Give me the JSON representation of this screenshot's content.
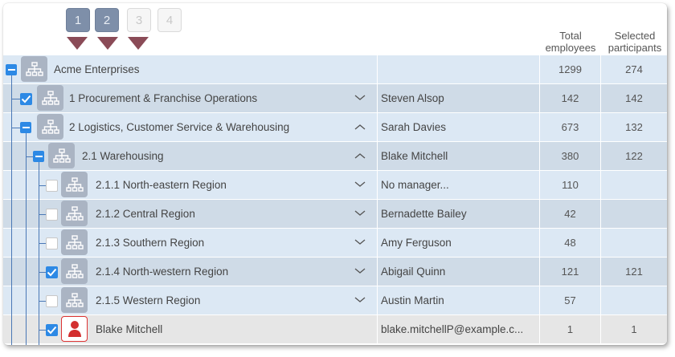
{
  "levels": [
    "1",
    "2",
    "3",
    "4"
  ],
  "headers": {
    "total": "Total employees",
    "selected": "Selected participants"
  },
  "colors": {
    "row_light": "#dce8f4",
    "row_dark": "#cfdbe7",
    "row_person": "#e6e6e6",
    "accent": "#2d89e5",
    "level_marker": "#8a4b57"
  },
  "rows": [
    {
      "name": "Acme Enterprises",
      "manager": "",
      "total": "1299",
      "selected": "274",
      "depth": 0,
      "control": "collapse",
      "chevron": "none",
      "icon": "org"
    },
    {
      "name": "1 Procurement & Franchise Operations",
      "manager": "Steven Alsop",
      "total": "142",
      "selected": "142",
      "depth": 1,
      "control": "checked",
      "chevron": "down",
      "icon": "org"
    },
    {
      "name": "2 Logistics, Customer Service & Warehousing",
      "manager": "Sarah Davies",
      "total": "673",
      "selected": "132",
      "depth": 1,
      "control": "collapse",
      "chevron": "up",
      "icon": "org"
    },
    {
      "name": "2.1 Warehousing",
      "manager": "Blake Mitchell",
      "total": "380",
      "selected": "122",
      "depth": 2,
      "control": "collapse",
      "chevron": "up",
      "icon": "org"
    },
    {
      "name": "2.1.1 North-eastern Region",
      "manager": "No manager...",
      "total": "110",
      "selected": "",
      "depth": 3,
      "control": "unchecked",
      "chevron": "down",
      "icon": "org"
    },
    {
      "name": "2.1.2 Central Region",
      "manager": "Bernadette Bailey",
      "total": "42",
      "selected": "",
      "depth": 3,
      "control": "unchecked",
      "chevron": "down",
      "icon": "org"
    },
    {
      "name": "2.1.3 Southern Region",
      "manager": "Amy Ferguson",
      "total": "48",
      "selected": "",
      "depth": 3,
      "control": "unchecked",
      "chevron": "down",
      "icon": "org"
    },
    {
      "name": "2.1.4 North-western Region",
      "manager": "Abigail Quinn",
      "total": "121",
      "selected": "121",
      "depth": 3,
      "control": "checked",
      "chevron": "down",
      "icon": "org"
    },
    {
      "name": "2.1.5 Western Region",
      "manager": "Austin Martin",
      "total": "57",
      "selected": "",
      "depth": 3,
      "control": "unchecked",
      "chevron": "down",
      "icon": "org"
    },
    {
      "name": "Blake Mitchell",
      "manager": "blake.mitchellP@example.c...",
      "total": "1",
      "selected": "1",
      "depth": 3,
      "control": "checked",
      "chevron": "none",
      "icon": "user"
    }
  ]
}
